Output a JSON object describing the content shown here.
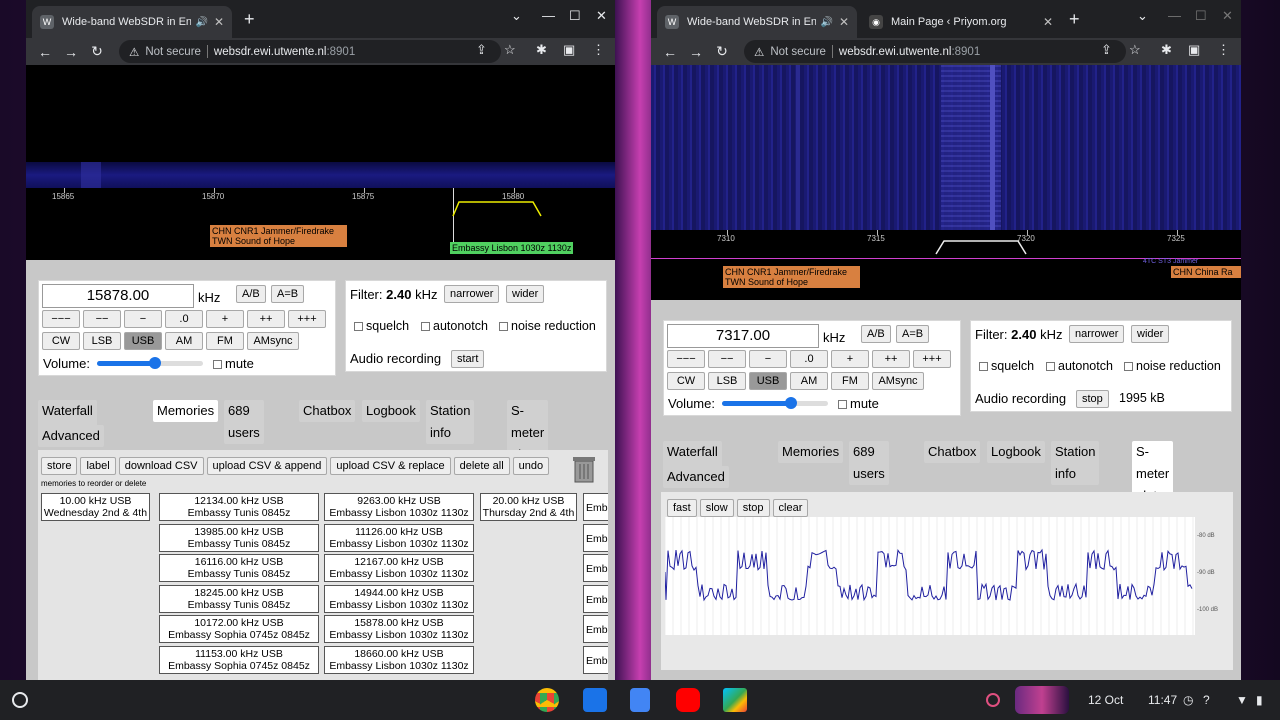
{
  "left": {
    "tab_title": "Wide-band WebSDR in Ensch",
    "url": "websdr.ewi.utwente.nl",
    "url_port": ":8901",
    "not_secure": "Not secure",
    "ticks": [
      "15865",
      "15870",
      "15875",
      "15880"
    ],
    "label1": "CHN CNR1 Jammer/Firedrake",
    "label2": "TWN Sound of Hope",
    "label3": "Embassy Lisbon 1030z 1130z",
    "frequency": "15878.00",
    "khz": "kHz",
    "ab": "A/B",
    "aeqb": "A=B",
    "steps": [
      "−−−",
      "−−",
      "−",
      ".0",
      "+",
      "++",
      "+++"
    ],
    "modes": [
      "CW",
      "LSB",
      "USB",
      "AM",
      "FM",
      "AMsync"
    ],
    "active_mode": "USB",
    "volume": "Volume:",
    "volume_level": 0.55,
    "mute": "mute",
    "filter_label": "Filter:",
    "filter_value": "2.40",
    "filter_unit": "kHz",
    "narrower": "narrower",
    "wider": "wider",
    "squelch": "squelch",
    "autonotch": "autonotch",
    "noise": "noise reduction",
    "audio": "Audio recording",
    "audio_btn": "start",
    "tabs": [
      "Waterfall settings",
      "Memories",
      "689 users",
      "Chatbox",
      "Logbook",
      "Station info",
      "S-meter plot",
      "Advanced"
    ],
    "active_tab": "Memories",
    "mem_btns": [
      "store",
      "label",
      "download CSV",
      "upload CSV & append",
      "upload CSV & replace",
      "delete all",
      "undo"
    ],
    "mem_hint": "memories to reorder or delete",
    "mem_col0": [
      {
        "f": "10.00 kHz USB",
        "n": "Wednesday 2nd & 4th"
      }
    ],
    "mem_col1": [
      {
        "f": "12134.00 kHz USB",
        "n": "Embassy Tunis 0845z"
      },
      {
        "f": "13985.00 kHz USB",
        "n": "Embassy Tunis 0845z"
      },
      {
        "f": "16116.00 kHz USB",
        "n": "Embassy Tunis 0845z"
      },
      {
        "f": "18245.00 kHz USB",
        "n": "Embassy Tunis 0845z"
      },
      {
        "f": "10172.00 kHz USB",
        "n": "Embassy Sophia 0745z 0845z"
      },
      {
        "f": "11153.00 kHz USB",
        "n": "Embassy Sophia 0745z 0845z"
      }
    ],
    "mem_col2": [
      {
        "f": "9263.00 kHz USB",
        "n": "Embassy Lisbon 1030z 1130z"
      },
      {
        "f": "11126.00 kHz USB",
        "n": "Embassy Lisbon 1030z 1130z"
      },
      {
        "f": "12167.00 kHz USB",
        "n": "Embassy Lisbon 1030z 1130z"
      },
      {
        "f": "14944.00 kHz USB",
        "n": "Embassy Lisbon 1030z 1130z"
      },
      {
        "f": "15878.00 kHz USB",
        "n": "Embassy Lisbon 1030z 1130z"
      },
      {
        "f": "18660.00 kHz USB",
        "n": "Embassy Lisbon 1030z 1130z"
      }
    ],
    "mem_col3": [
      {
        "f": "20.00 kHz USB",
        "n": "Thursday 2nd & 4th"
      }
    ],
    "mem_col4": [
      "Emba",
      "Emba",
      "Emba",
      "Emb",
      "Emb",
      "Emb"
    ]
  },
  "right": {
    "tab_title": "Wide-band WebSDR in Ensch",
    "tab2_title": "Main Page ‹ Priyom.org",
    "url": "websdr.ewi.utwente.nl",
    "url_port": ":8901",
    "not_secure": "Not secure",
    "ticks": [
      "7310",
      "7315",
      "7320",
      "7325"
    ],
    "label1": "CHN CNR1 Jammer/Firedrake",
    "label2": "TWN Sound of Hope",
    "label3": "CHN China Ra",
    "label4": "4TC ST3 Jammer",
    "frequency": "7317.00",
    "khz": "kHz",
    "ab": "A/B",
    "aeqb": "A=B",
    "steps": [
      "−−−",
      "−−",
      "−",
      ".0",
      "+",
      "++",
      "+++"
    ],
    "modes": [
      "CW",
      "LSB",
      "USB",
      "AM",
      "FM",
      "AMsync"
    ],
    "active_mode": "USB",
    "volume": "Volume:",
    "volume_level": 0.65,
    "mute": "mute",
    "filter_label": "Filter:",
    "filter_value": "2.40",
    "filter_unit": "kHz",
    "narrower": "narrower",
    "wider": "wider",
    "squelch": "squelch",
    "autonotch": "autonotch",
    "noise": "noise reduction",
    "audio": "Audio recording",
    "audio_btn": "stop",
    "audio_size": "1995 kB",
    "tabs": [
      "Waterfall settings",
      "Memories",
      "689 users",
      "Chatbox",
      "Logbook",
      "Station info",
      "S-meter plot",
      "Advanced"
    ],
    "active_tab": "S-meter plot",
    "plot_btns": [
      "fast",
      "slow",
      "stop",
      "clear"
    ],
    "db_labels": [
      "-80 dB",
      "-90 dB",
      "-100 dB"
    ]
  },
  "shelf": {
    "date": "12 Oct",
    "time": "11:47"
  }
}
